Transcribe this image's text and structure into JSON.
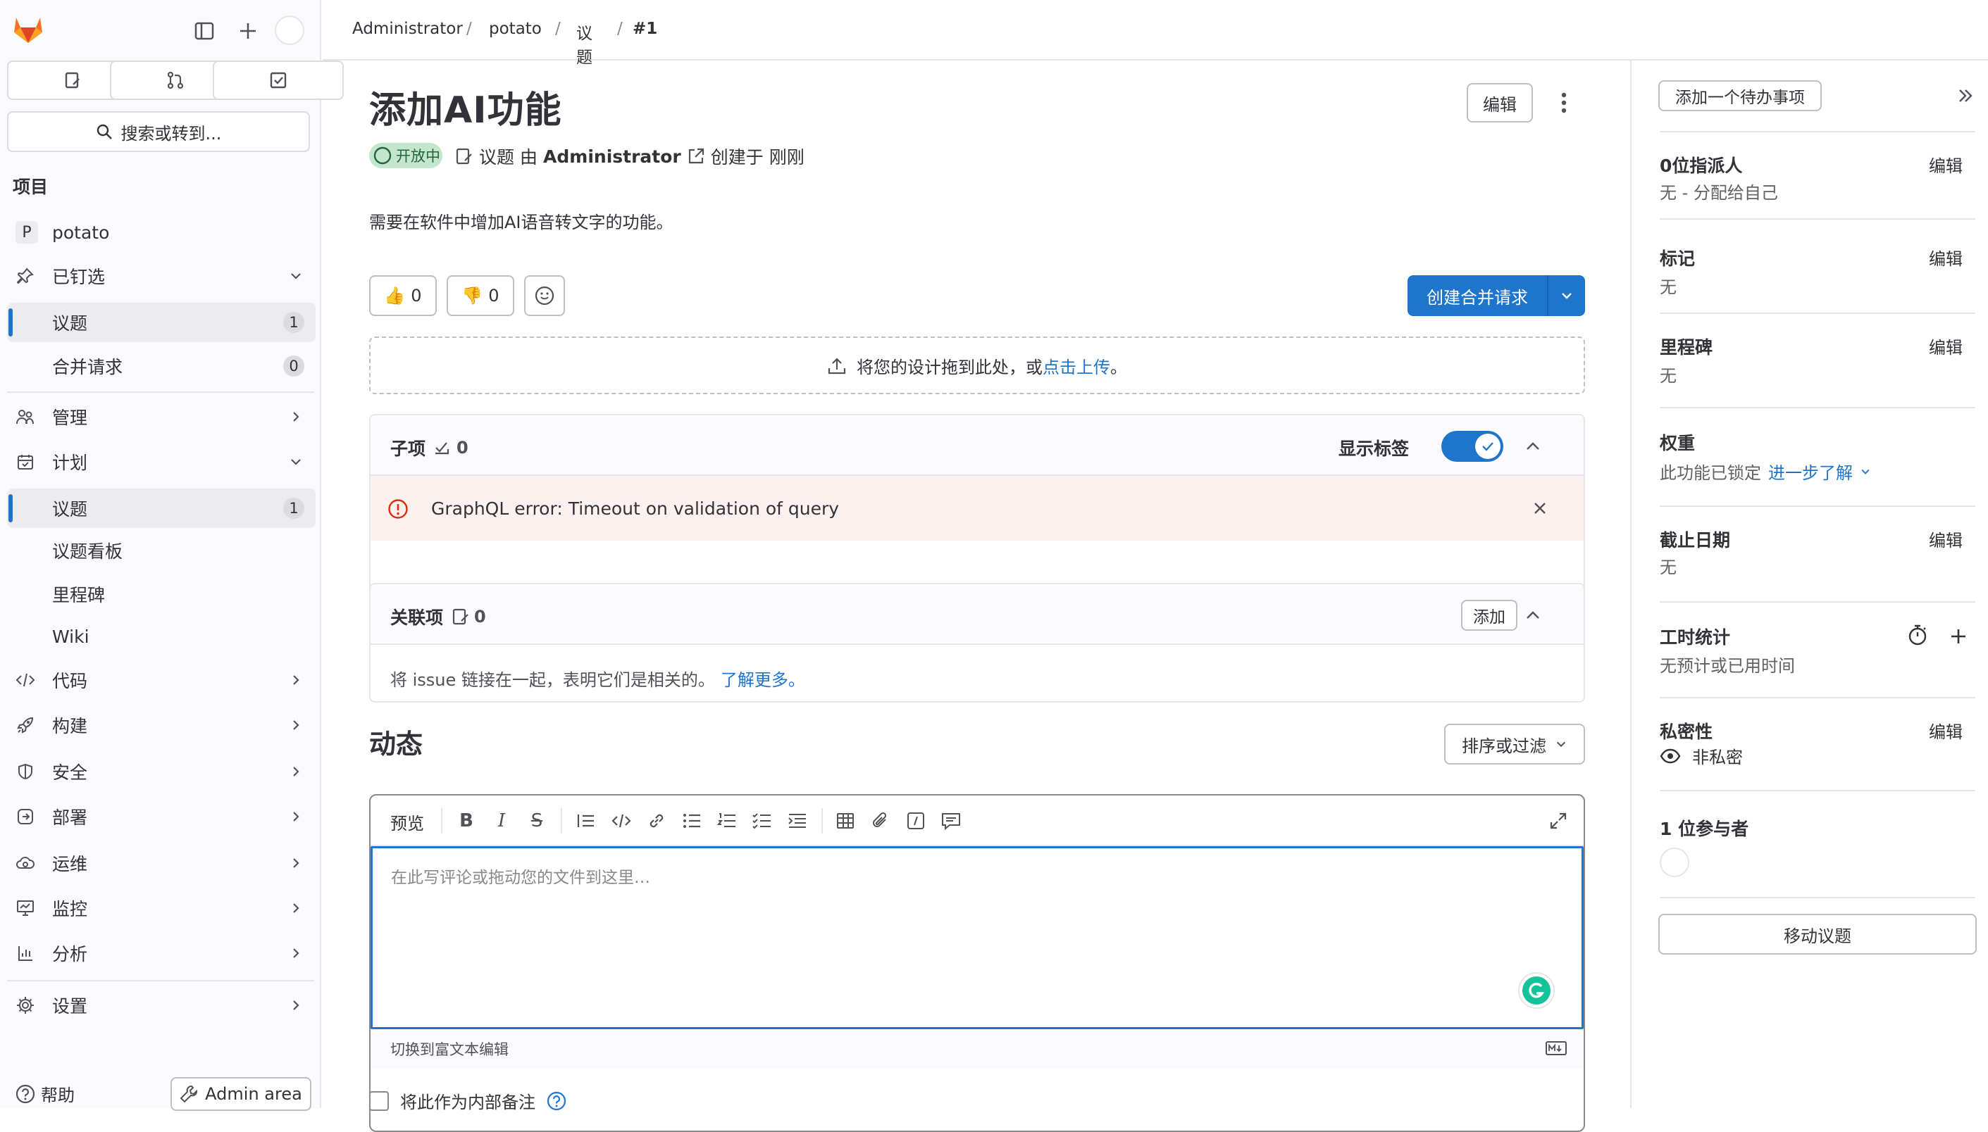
{
  "sidebar": {
    "search_label": "搜索或转到...",
    "section_title": "项目",
    "project": {
      "initial": "P",
      "name": "potato"
    },
    "pinned": {
      "label": "已钉选",
      "items": [
        {
          "label": "议题",
          "count": "1"
        },
        {
          "label": "合并请求",
          "count": "0"
        }
      ]
    },
    "manage_label": "管理",
    "plan": {
      "label": "计划",
      "items": [
        {
          "label": "议题",
          "count": "1"
        },
        {
          "label": "议题看板"
        },
        {
          "label": "里程碑"
        },
        {
          "label": "Wiki"
        }
      ]
    },
    "nav": [
      {
        "label": "代码"
      },
      {
        "label": "构建"
      },
      {
        "label": "安全"
      },
      {
        "label": "部署"
      },
      {
        "label": "运维"
      },
      {
        "label": "监控"
      },
      {
        "label": "分析"
      }
    ],
    "settings_label": "设置",
    "help_label": "帮助",
    "admin_label": "Admin area"
  },
  "breadcrumb": {
    "items": [
      "Administrator",
      "potato",
      "议题",
      "#1"
    ],
    "sep": "/"
  },
  "issue": {
    "title": "添加AI功能",
    "edit_label": "编辑",
    "status": "开放中",
    "meta_issue": "议题",
    "meta_by": "由",
    "author": "Administrator",
    "meta_created": "创建于",
    "created_time": "刚刚",
    "description": "需要在软件中增加AI语音转文字的功能。",
    "thumbs_up_count": "0",
    "thumbs_down_count": "0",
    "create_mr_label": "创建合并请求",
    "dropzone_text": "将您的设计拖到此处，或",
    "dropzone_link": "点击上传",
    "dropzone_end": "。"
  },
  "child_items": {
    "title": "子项",
    "count": "0",
    "show_labels": "显示标签",
    "error": "GraphQL error: Timeout on validation of query"
  },
  "linked_items": {
    "title": "关联项",
    "count": "0",
    "add_label": "添加",
    "help_text": "将 issue 链接在一起，表明它们是相关的。",
    "learn_more": "了解更多。"
  },
  "activity": {
    "title": "动态",
    "sort_label": "排序或过滤",
    "preview_label": "预览",
    "placeholder": "在此写评论或拖动您的文件到这里…",
    "switch_label": "切换到富文本编辑",
    "internal_note": "将此作为内部备注"
  },
  "right_sidebar": {
    "todo_label": "添加一个待办事项",
    "edit_label": "编辑",
    "assignee": {
      "title": "0位指派人",
      "value": "无 - 分配给自己"
    },
    "labels": {
      "title": "标记",
      "value": "无"
    },
    "milestone": {
      "title": "里程碑",
      "value": "无"
    },
    "weight": {
      "title": "权重",
      "value": "此功能已锁定",
      "link": "进一步了解"
    },
    "due_date": {
      "title": "截止日期",
      "value": "无"
    },
    "time_tracking": {
      "title": "工时统计",
      "value": "无预计或已用时间"
    },
    "confidentiality": {
      "title": "私密性",
      "value": "非私密"
    },
    "participants": {
      "title": "1 位参与者"
    },
    "move_label": "移动议题"
  },
  "colors": {
    "accent": "#1f75cb",
    "open_badge": "#c3e6cd",
    "alert_bg": "#fcf1ef",
    "danger": "#dd2b0e"
  }
}
